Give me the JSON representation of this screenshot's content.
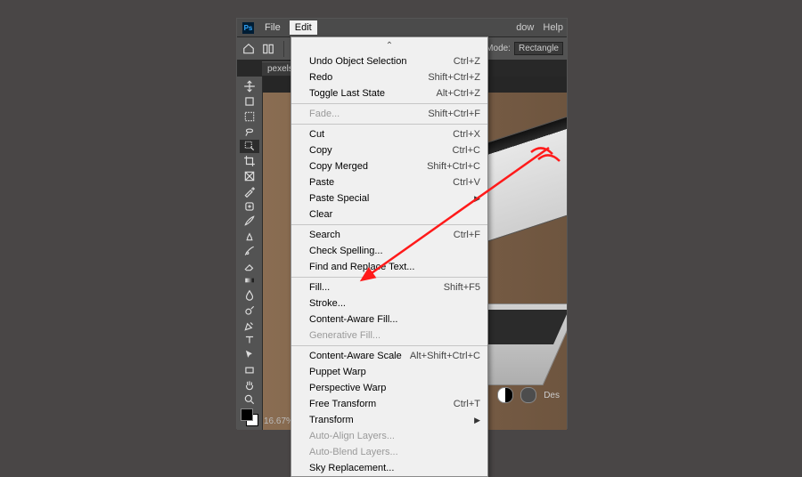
{
  "menu": {
    "file": "File",
    "edit": "Edit",
    "right": {
      "dow": "dow",
      "help": "Help"
    }
  },
  "options_bar": {
    "mode_label": "Mode:",
    "mode_value": "Rectangle"
  },
  "document_tab": "pexels-...",
  "zoom": "16.67%",
  "canvas_controls": {
    "des": "Des"
  },
  "edit_menu": {
    "groups": [
      [
        {
          "label": "Undo Object Selection",
          "shortcut": "Ctrl+Z",
          "enabled": true
        },
        {
          "label": "Redo",
          "shortcut": "Shift+Ctrl+Z",
          "enabled": true
        },
        {
          "label": "Toggle Last State",
          "shortcut": "Alt+Ctrl+Z",
          "enabled": true
        }
      ],
      [
        {
          "label": "Fade...",
          "shortcut": "Shift+Ctrl+F",
          "enabled": false
        }
      ],
      [
        {
          "label": "Cut",
          "shortcut": "Ctrl+X",
          "enabled": true
        },
        {
          "label": "Copy",
          "shortcut": "Ctrl+C",
          "enabled": true
        },
        {
          "label": "Copy Merged",
          "shortcut": "Shift+Ctrl+C",
          "enabled": true
        },
        {
          "label": "Paste",
          "shortcut": "Ctrl+V",
          "enabled": true
        },
        {
          "label": "Paste Special",
          "submenu": true,
          "enabled": true
        },
        {
          "label": "Clear",
          "enabled": true
        }
      ],
      [
        {
          "label": "Search",
          "shortcut": "Ctrl+F",
          "enabled": true
        },
        {
          "label": "Check Spelling...",
          "enabled": true
        },
        {
          "label": "Find and Replace Text...",
          "enabled": true
        }
      ],
      [
        {
          "label": "Fill...",
          "shortcut": "Shift+F5",
          "enabled": true
        },
        {
          "label": "Stroke...",
          "enabled": true
        },
        {
          "label": "Content-Aware Fill...",
          "enabled": true
        },
        {
          "label": "Generative Fill...",
          "enabled": false
        }
      ],
      [
        {
          "label": "Content-Aware Scale",
          "shortcut": "Alt+Shift+Ctrl+C",
          "enabled": true
        },
        {
          "label": "Puppet Warp",
          "enabled": true
        },
        {
          "label": "Perspective Warp",
          "enabled": true
        },
        {
          "label": "Free Transform",
          "shortcut": "Ctrl+T",
          "enabled": true
        },
        {
          "label": "Transform",
          "submenu": true,
          "enabled": true
        },
        {
          "label": "Auto-Align Layers...",
          "enabled": false
        },
        {
          "label": "Auto-Blend Layers...",
          "enabled": false
        },
        {
          "label": "Sky Replacement...",
          "enabled": true
        }
      ]
    ]
  },
  "tools": [
    "move-tool",
    "artboard-tool",
    "rect-marquee-tool",
    "lasso-tool",
    "object-selection-tool",
    "crop-tool",
    "frame-tool",
    "eyedropper-tool",
    "healing-brush-tool",
    "brush-tool",
    "clone-stamp-tool",
    "history-brush-tool",
    "eraser-tool",
    "gradient-tool",
    "blur-tool",
    "dodge-tool",
    "pen-tool",
    "type-tool",
    "path-selection-tool",
    "rectangle-shape-tool",
    "hand-tool",
    "zoom-tool"
  ]
}
